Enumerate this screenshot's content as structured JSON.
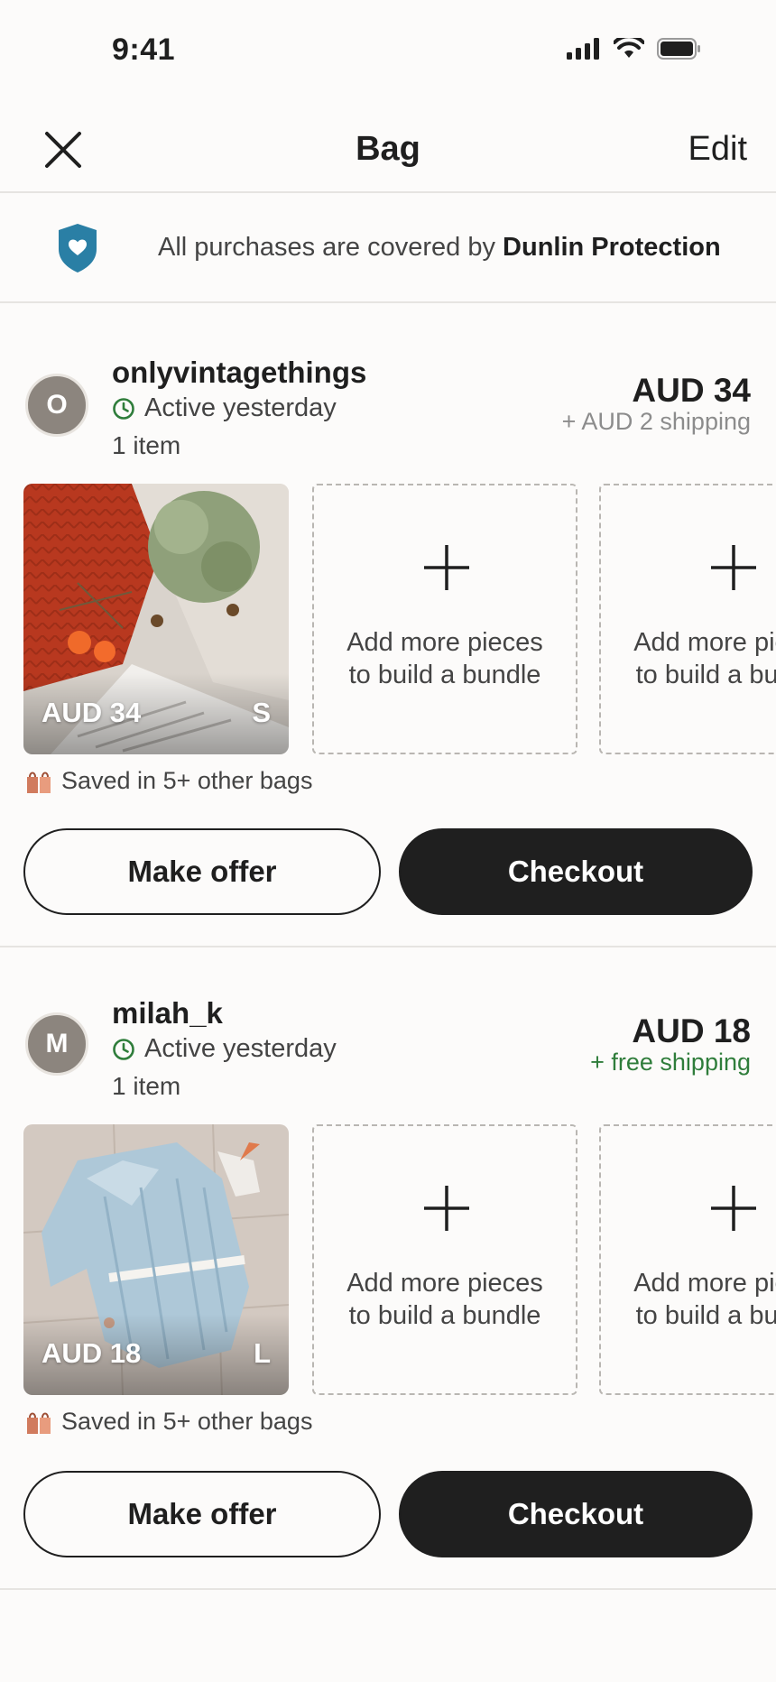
{
  "status_bar": {
    "time": "9:41"
  },
  "nav": {
    "title": "Bag",
    "edit_label": "Edit"
  },
  "protection": {
    "prefix": "All purchases are covered by ",
    "brand": "Dunlin Protection"
  },
  "add_card": {
    "line1": "Add more pieces",
    "line2": "to build a bundle"
  },
  "sellers": [
    {
      "initial": "O",
      "name": "onlyvintagethings",
      "active": "Active yesterday",
      "count": "1 item",
      "total": "AUD 34",
      "shipping": "+ AUD 2 shipping",
      "item_price": "AUD 34",
      "item_size": "S",
      "saved": "Saved in 5+ other bags",
      "offer_label": "Make offer",
      "checkout_label": "Checkout"
    },
    {
      "initial": "M",
      "name": "milah_k",
      "active": "Active yesterday",
      "count": "1 item",
      "total": "AUD 18",
      "shipping": "+ free shipping",
      "item_price": "AUD 18",
      "item_size": "L",
      "saved": "Saved in 5+ other bags",
      "offer_label": "Make offer",
      "checkout_label": "Checkout"
    }
  ],
  "colors": {
    "accent_dark": "#1f1f1f",
    "shield": "#2a7fa5",
    "free_shipping": "#2f7d3b",
    "background": "#fcfbfa"
  }
}
